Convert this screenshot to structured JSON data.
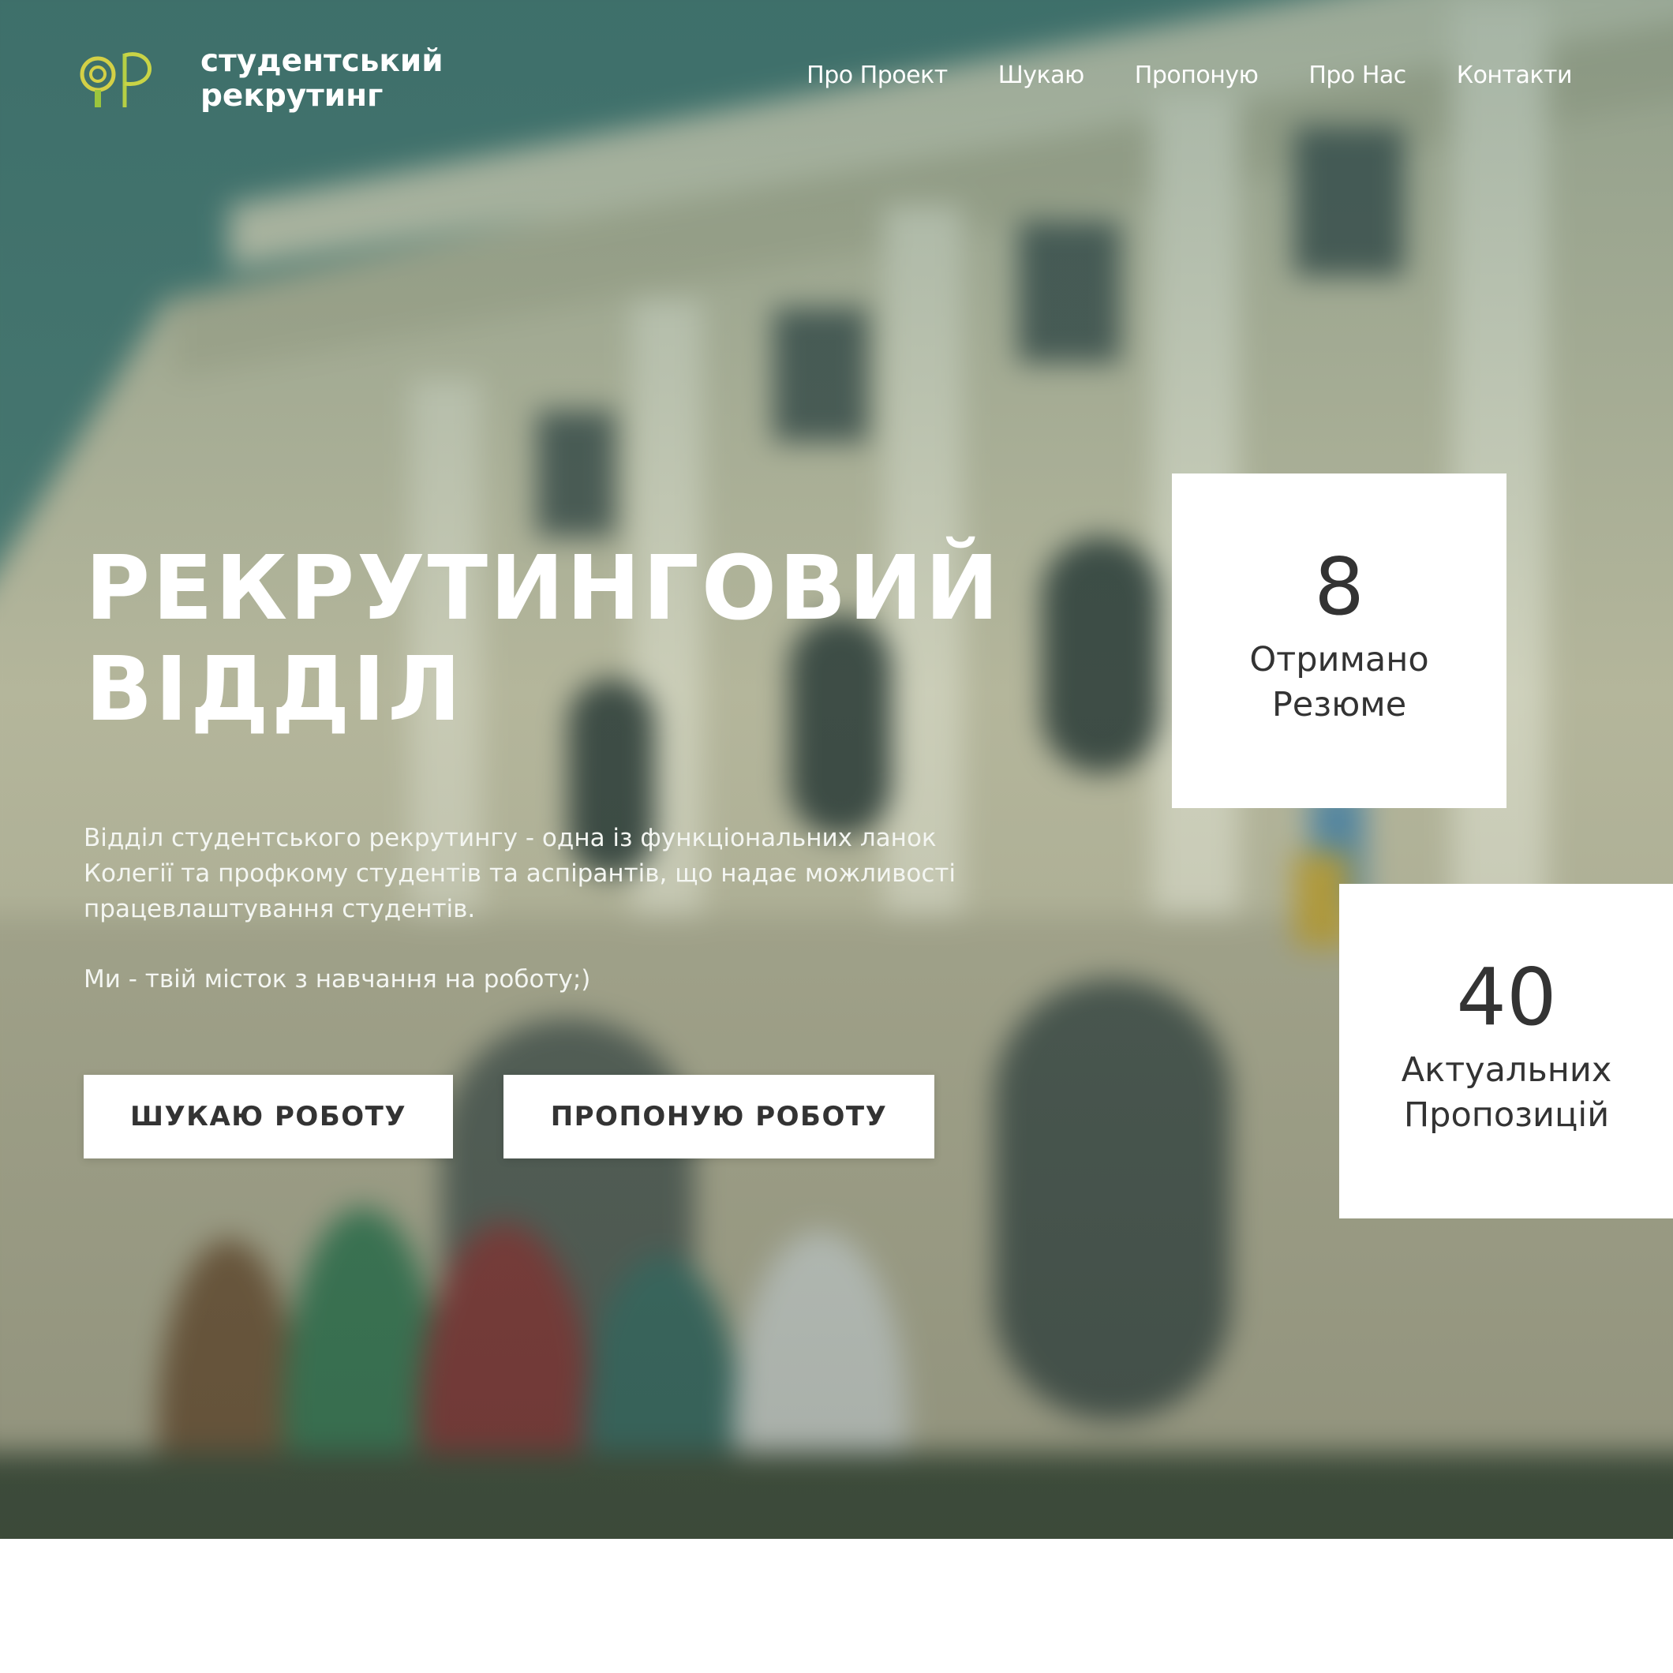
{
  "brand": {
    "line1": "студентський",
    "line2": "рекрутинг",
    "logo_icon": "cp-magnifier-logo",
    "logo_colors": [
      "#d7d447",
      "#9bc53d"
    ]
  },
  "nav": {
    "items": [
      {
        "label": "Про Проект"
      },
      {
        "label": "Шукаю"
      },
      {
        "label": "Пропоную"
      },
      {
        "label": "Про Нас"
      },
      {
        "label": "Контакти"
      }
    ]
  },
  "hero": {
    "title_line1": "РЕКРУТИНГОВИЙ",
    "title_line2": "ВІДДІЛ",
    "description": "Відділ студентського рекрутингу - одна із функціональних ланок Колегії та профкому студентів та аспірантів, що надає можливості працевлаштування студентів.",
    "tagline": "Ми - твій місток з навчання на роботу;)",
    "buttons": {
      "seek": "ШУКАЮ РОБОТУ",
      "offer": "ПРОПОНУЮ РОБОТУ"
    }
  },
  "stats": {
    "resumes": {
      "number": "8",
      "label_line1": "Отримано",
      "label_line2": "Резюме"
    },
    "offers": {
      "number": "40",
      "label_line1": "Актуальних",
      "label_line2": "Пропозицій"
    }
  },
  "colors": {
    "button_bg": "#ffffff",
    "button_text": "#333333",
    "card_bg": "#ffffff",
    "card_text": "#333333",
    "hero_text": "#ffffff"
  }
}
